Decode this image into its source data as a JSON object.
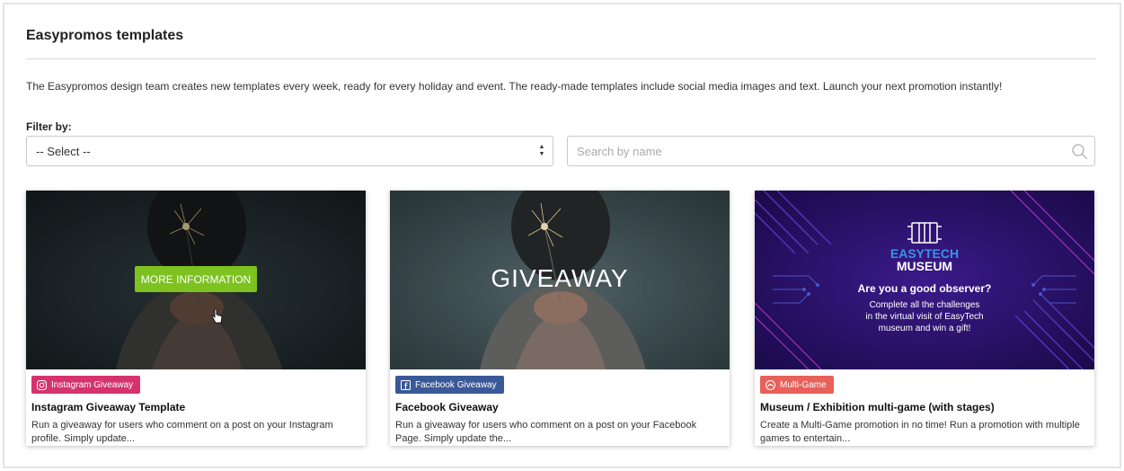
{
  "panel": {
    "title": "Easypromos templates",
    "intro": "The Easypromos design team creates new templates every week, ready for every holiday and event. The ready-made templates include social media images and text. Launch your next promotion instantly!"
  },
  "filter": {
    "label": "Filter by:",
    "select_value": "-- Select --",
    "search_placeholder": "Search by name",
    "search_value": ""
  },
  "cards": [
    {
      "image_overlay_button": "MORE INFORMATION",
      "badge": {
        "label": "Instagram Giveaway",
        "icon": "instagram-icon",
        "color": "#d6336c"
      },
      "title": "Instagram Giveaway Template",
      "description": "Run a giveaway for users who comment on a post on your Instagram profile. Simply update..."
    },
    {
      "image_text": "GIVEAWAY",
      "badge": {
        "label": "Facebook Giveaway",
        "icon": "facebook-icon",
        "color": "#3b5998"
      },
      "title": "Facebook Giveaway",
      "description": "Run a giveaway for users who comment on a post on your Facebook Page. Simply update the..."
    },
    {
      "image_text": {
        "brand_top": "EASYTECH",
        "brand_bottom": "MUSEUM",
        "question": "Are you a good observer?",
        "lines": [
          "Complete all the challenges",
          "in the virtual visit of EasyTech",
          "museum and win a gift!"
        ]
      },
      "badge": {
        "label": "Multi-Game",
        "icon": "gamepad-icon",
        "color": "#e8605a"
      },
      "title": "Museum / Exhibition multi-game (with stages)",
      "description": "Create a Multi-Game promotion in no time! Run a promotion with multiple games to entertain..."
    }
  ],
  "colors": {
    "accent_green": "#7dc21e",
    "border": "#c9c9c9"
  }
}
